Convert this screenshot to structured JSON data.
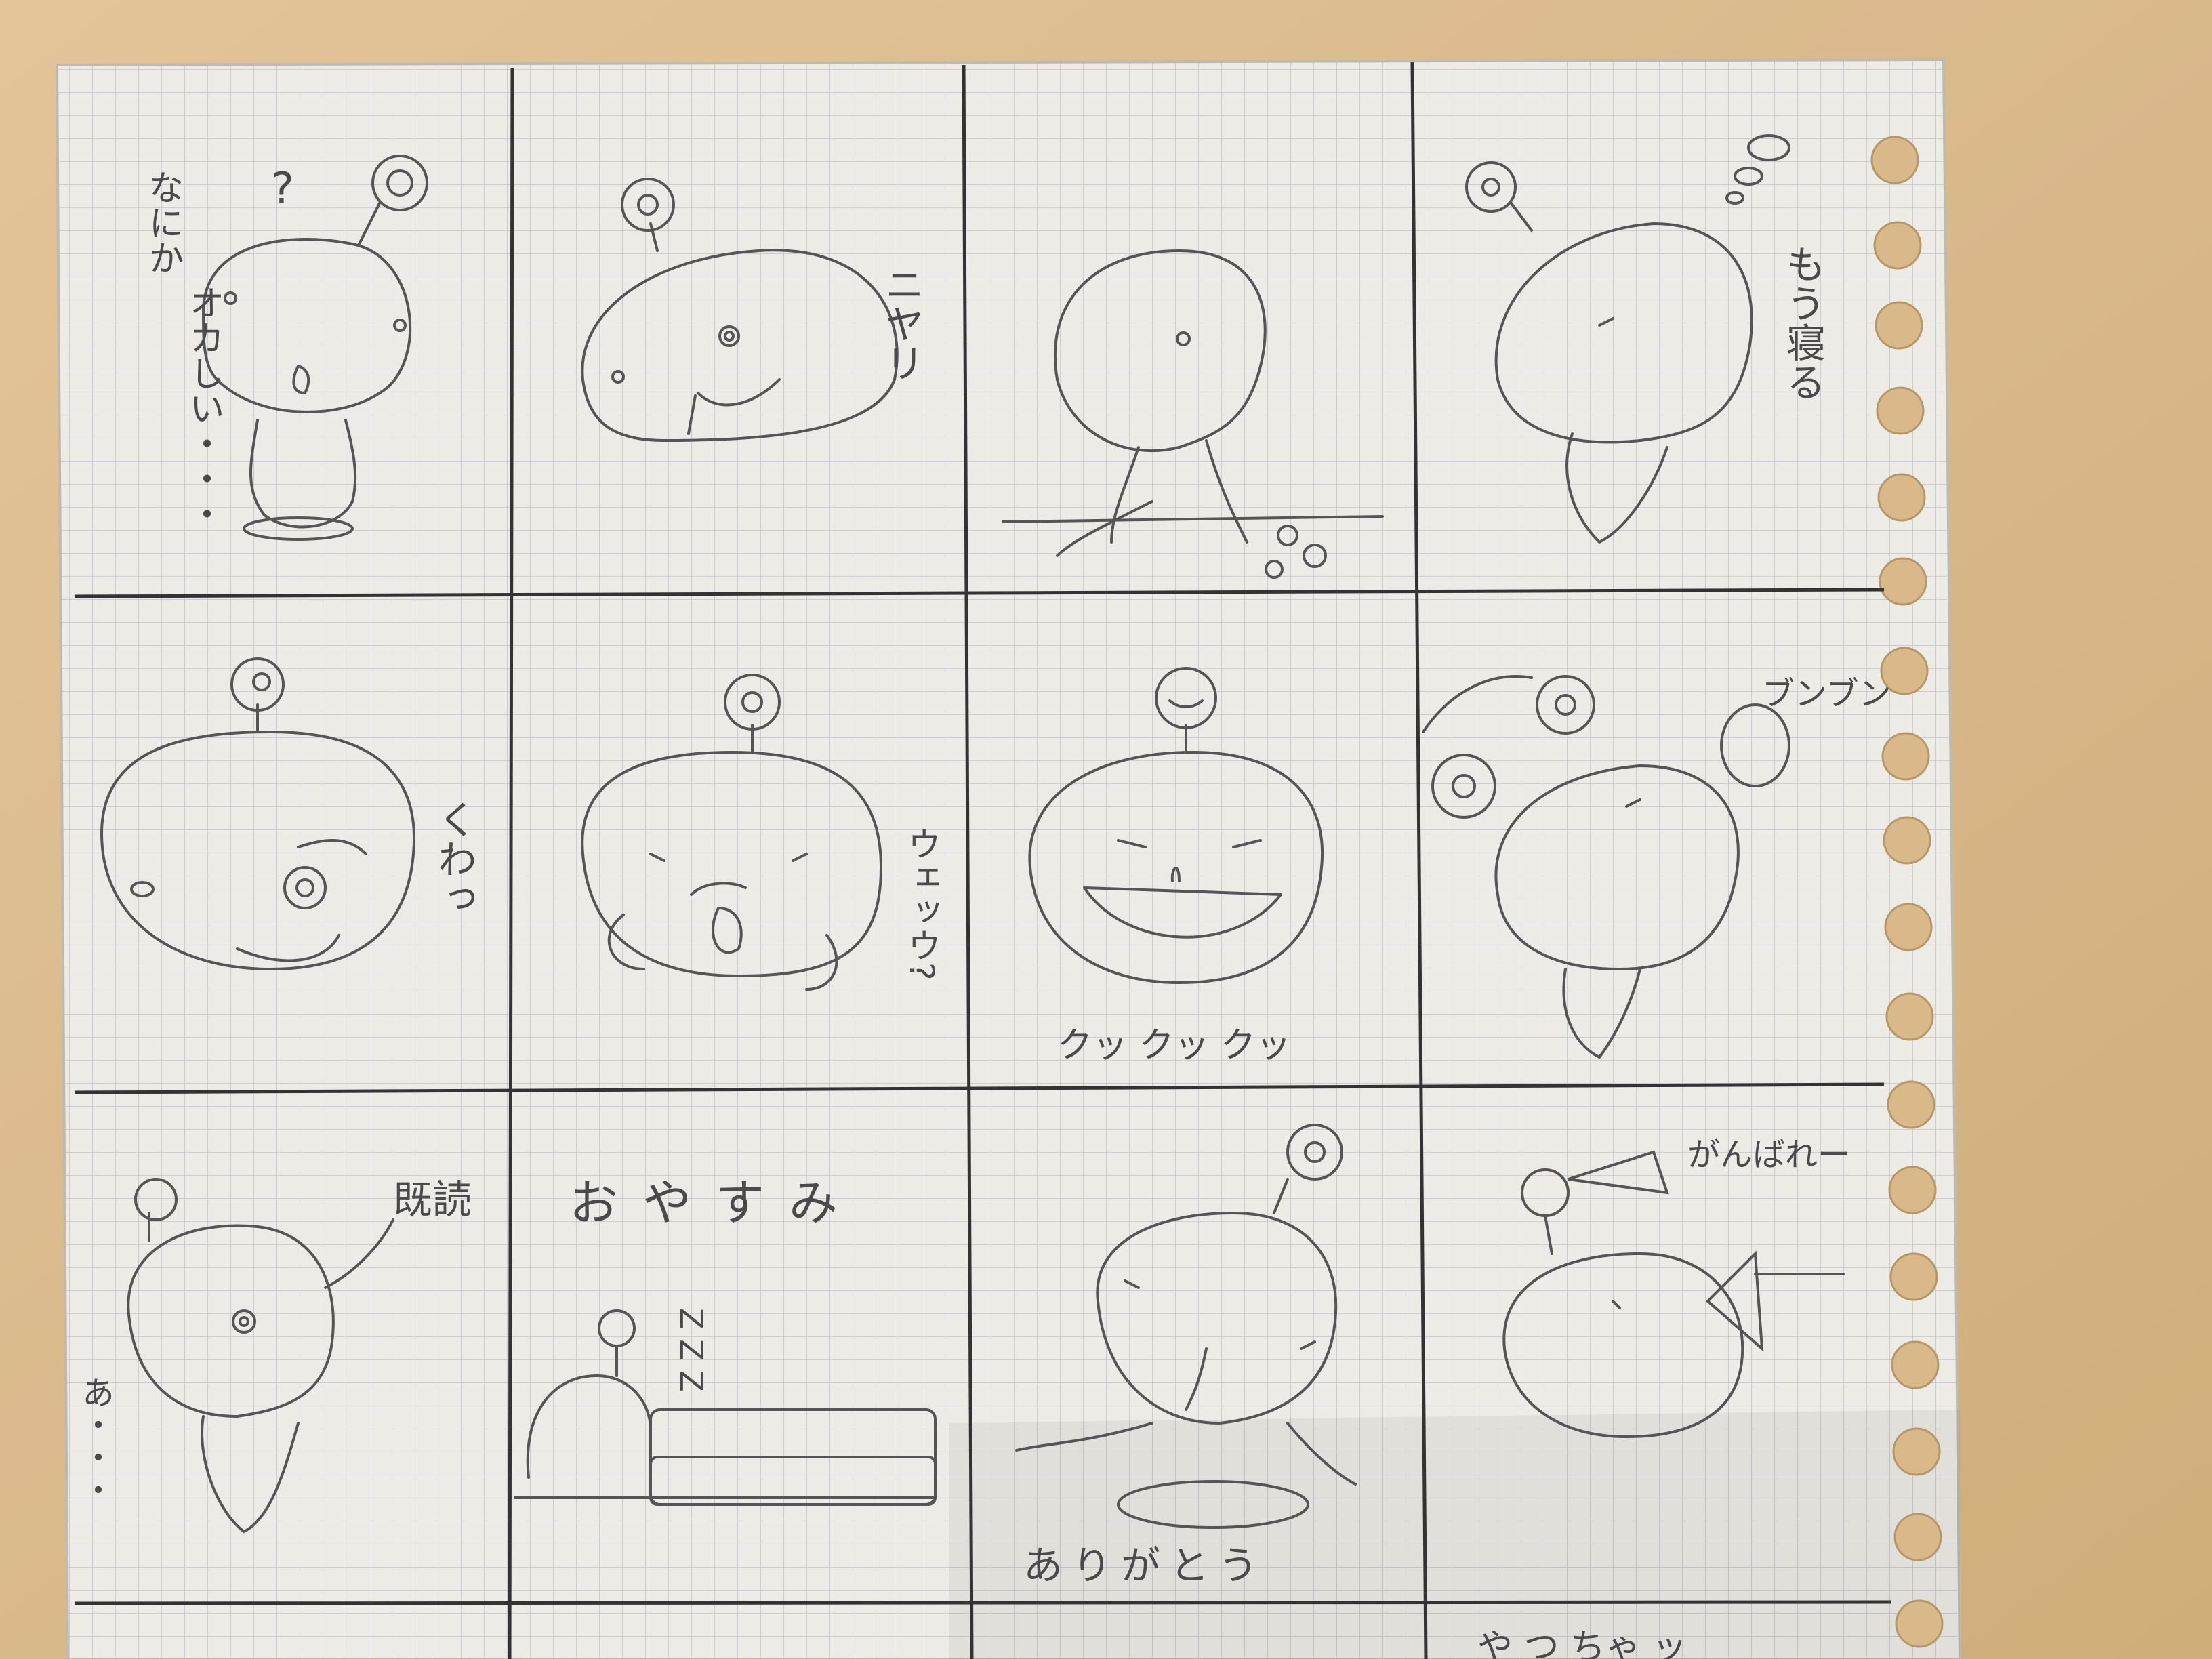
{
  "scene": {
    "subject": "graph-paper-sketch",
    "paper_color": "#ecebe6",
    "pencil_color": "#3a3a3a",
    "table_color": "#d9b98a"
  },
  "panels": [
    {
      "id": "r1c1",
      "lines": [
        "なにか",
        "オカしい・・・"
      ],
      "mark": "?"
    },
    {
      "id": "r1c2",
      "lines": [
        "ニヤリ"
      ]
    },
    {
      "id": "r1c3",
      "lines": []
    },
    {
      "id": "r1c4",
      "lines": [
        "もう寝る"
      ]
    },
    {
      "id": "r2c1",
      "lines": [
        "くわっ"
      ]
    },
    {
      "id": "r2c2",
      "lines": [
        "ウェッウ?"
      ]
    },
    {
      "id": "r2c3",
      "lines": [
        "クッ クッ クッ"
      ]
    },
    {
      "id": "r2c4",
      "lines": [
        "ブンブン"
      ]
    },
    {
      "id": "r3c1",
      "lines": [
        "既読",
        "あ・・・"
      ]
    },
    {
      "id": "r3c2",
      "lines": [
        "おやすみ",
        "Z Z Z"
      ]
    },
    {
      "id": "r3c3",
      "lines": [
        "ありがとう"
      ]
    },
    {
      "id": "r3c4",
      "lines": [
        "がんばれー"
      ]
    },
    {
      "id": "r4c4",
      "lines": [
        "や つ ちゃ ッ"
      ]
    }
  ]
}
